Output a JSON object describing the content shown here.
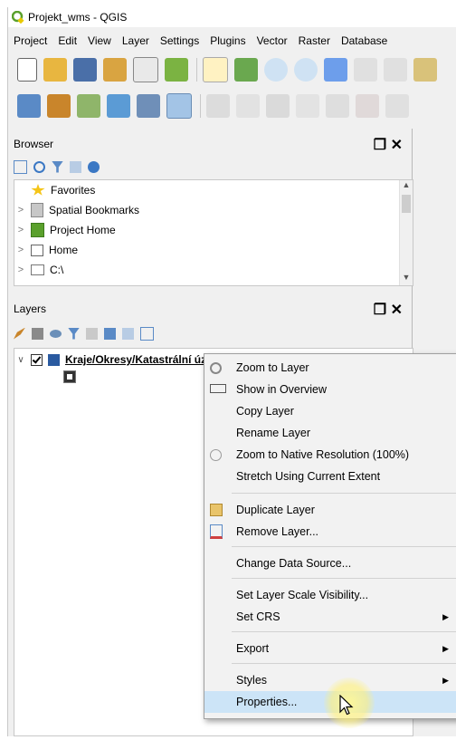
{
  "window": {
    "title": "Projekt_wms - QGIS"
  },
  "menubar": [
    "Project",
    "Edit",
    "View",
    "Layer",
    "Settings",
    "Plugins",
    "Vector",
    "Raster",
    "Database"
  ],
  "browser": {
    "title": "Browser",
    "items": [
      {
        "label": "Favorites",
        "icon": "star-icon"
      },
      {
        "label": "Spatial Bookmarks",
        "icon": "bookmark-icon"
      },
      {
        "label": "Project Home",
        "icon": "project-home-icon"
      },
      {
        "label": "Home",
        "icon": "home-icon"
      },
      {
        "label": "C:\\",
        "icon": "folder-icon"
      }
    ]
  },
  "layers": {
    "title": "Layers",
    "layer_name": "Kraje/Okresy/Katastrální území/Územní ZÚOB/Ob"
  },
  "context_menu": {
    "items": [
      "Zoom to Layer",
      "Show in Overview",
      "Copy Layer",
      "Rename Layer",
      "Zoom to Native Resolution (100%)",
      "Stretch Using Current Extent",
      "Duplicate Layer",
      "Remove Layer...",
      "Change Data Source...",
      "Set Layer Scale Visibility...",
      "Set CRS",
      "Export",
      "Styles",
      "Properties..."
    ],
    "highlighted": "Properties..."
  },
  "colors": {
    "highlight": "#cce4f7",
    "qgis_green": "#5aa02c"
  }
}
